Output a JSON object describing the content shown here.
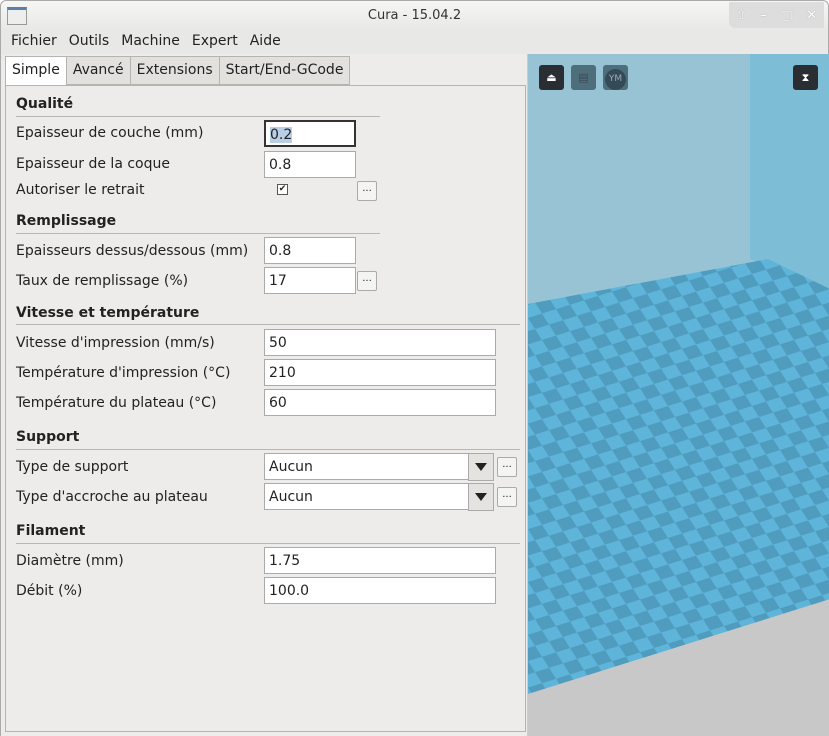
{
  "window": {
    "title": "Cura - 15.04.2",
    "buttons": [
      "⇧",
      "–",
      "▢",
      "✕"
    ]
  },
  "menu": [
    "Fichier",
    "Outils",
    "Machine",
    "Expert",
    "Aide"
  ],
  "tabs": [
    "Simple",
    "Avancé",
    "Extensions",
    "Start/End-GCode"
  ],
  "sections": {
    "quality": {
      "title": "Qualité",
      "layer_label": "Epaisseur de couche (mm)",
      "layer_value": "0.2",
      "shell_label": "Epaisseur de la coque",
      "shell_value": "0.8",
      "retract_label": "Autoriser le retrait",
      "retract_checked": true
    },
    "fill": {
      "title": "Remplissage",
      "topbottom_label": "Epaisseurs dessus/dessous (mm)",
      "topbottom_value": "0.8",
      "density_label": "Taux de remplissage (%)",
      "density_value": "17"
    },
    "speed": {
      "title": "Vitesse et température",
      "speed_label": "Vitesse d'impression (mm/s)",
      "speed_value": "50",
      "temp_label": "Température d'impression (°C)",
      "temp_value": "210",
      "bed_label": "Température du plateau (°C)",
      "bed_value": "60"
    },
    "support": {
      "title": "Support",
      "type_label": "Type de support",
      "type_value": "Aucun",
      "adhesion_label": "Type d'accroche au plateau",
      "adhesion_value": "Aucun"
    },
    "filament": {
      "title": "Filament",
      "diameter_label": "Diamètre (mm)",
      "diameter_value": "1.75",
      "flow_label": "Débit (%)",
      "flow_value": "100.0"
    }
  },
  "more_label": "...",
  "viewer": {
    "ym_label": "YM",
    "colors": {
      "bg": "#97c3d5",
      "wall": "#7dbdd6",
      "tile_a": "#5fb4da",
      "tile_b": "#4f9cbf",
      "bottom": "#c8c8c8"
    }
  }
}
